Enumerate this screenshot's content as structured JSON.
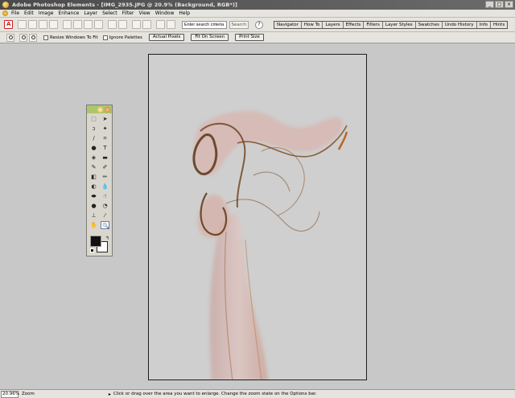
{
  "window": {
    "title": "Adobe Photoshop Elements - [IMG_2935.JPG @ 20.9% (Background, RGB*)]"
  },
  "menu": {
    "items": [
      "File",
      "Edit",
      "Image",
      "Enhance",
      "Layer",
      "Select",
      "Filter",
      "View",
      "Window",
      "Help"
    ]
  },
  "toolbar": {
    "search_value": "Enter search criteria",
    "search_button": "Search",
    "help_icon": "help-icon"
  },
  "palette_well": {
    "tabs": [
      "Navigator",
      "How To",
      "Layers",
      "Effects",
      "Filters",
      "Layer Styles",
      "Swatches",
      "Undo History",
      "Info",
      "Hints"
    ]
  },
  "options": {
    "resize_windows_label": "Resize Windows To Fit",
    "ignore_palettes_label": "Ignore Palettes",
    "actual_pixels": "Actual Pixels",
    "fit_on_screen": "Fit On Screen",
    "print_size": "Print Size"
  },
  "status": {
    "zoom": "20.96%",
    "tool": "Zoom",
    "message": "Click or drag over the area you want to enlarge. Change the zoom state on the Options bar."
  },
  "colors": {
    "foreground": "#111111",
    "background": "#ffffff",
    "smoke": "#7a4a1a"
  }
}
